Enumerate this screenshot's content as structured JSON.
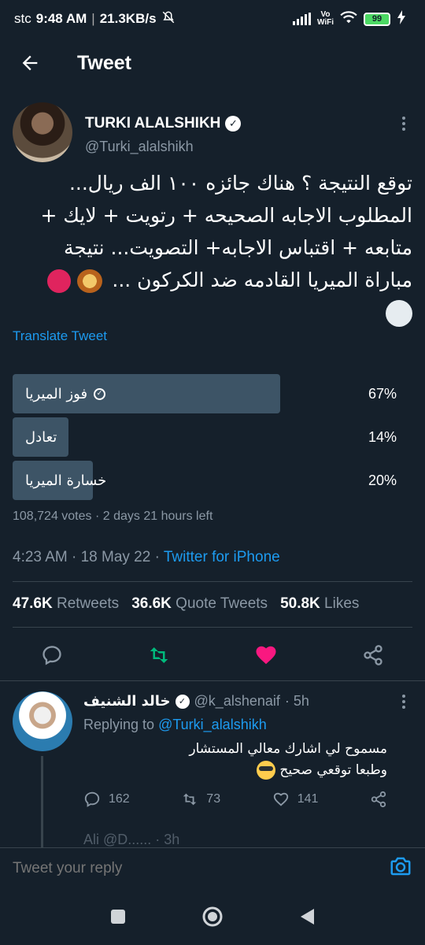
{
  "status_bar": {
    "carrier": "stc",
    "time": "9:48 AM",
    "speed": "21.3KB/s",
    "vowifi_top": "Vo",
    "vowifi_bottom": "WiFi",
    "battery": "99",
    "battery_color": "#4cd964"
  },
  "header": {
    "title": "Tweet",
    "back_icon": "arrow-left-icon"
  },
  "tweet": {
    "author_name": "TURKI ALALSHIKH",
    "author_handle": "@Turki_alalshikh",
    "text_line1": "توقع النتيجة ؟ هناك جائزه ١٠٠ الف ريال...",
    "text_line2": "المطلوب الاجابه الصحيحه + رتويت + لايك +",
    "text_line3": "متابعه + اقتباس الاجابه+ التصويت... نتيجة",
    "text_line4": "مباراة الميريا القادمه ضد الكركون ...",
    "translate": "Translate Tweet",
    "poll": {
      "options": [
        {
          "label": "فوز الميريا",
          "percent": "67%",
          "fraction": 0.67,
          "winner": true
        },
        {
          "label": "تعادل",
          "percent": "14%",
          "fraction": 0.14,
          "winner": false
        },
        {
          "label": "خسارة الميريا",
          "percent": "20%",
          "fraction": 0.2,
          "winner": false
        }
      ],
      "meta": "108,724 votes · 2 days 21 hours left"
    },
    "time": "4:23 AM · 18 May 22 · ",
    "source": "Twitter for iPhone",
    "stats": {
      "retweets_count": "47.6K",
      "retweets_label": "Retweets",
      "quotes_count": "36.6K",
      "quotes_label": "Quote Tweets",
      "likes_count": "50.8K",
      "likes_label": "Likes"
    },
    "accent_color": "#1d9bf0",
    "retweet_color": "#00ba7c",
    "like_color": "#f91880"
  },
  "reply": {
    "name": "خالد الشنيف",
    "handle": "@k_alshenaif",
    "time": "· 5h",
    "replying_prefix": "Replying to ",
    "replying_to": "@Turki_alalshikh",
    "text_line1": "مسموح لي اشارك معالي المستشار",
    "text_line2": "وطبعا توقعي صحيح",
    "replies": "162",
    "retweets": "73",
    "likes": "141"
  },
  "next_reply_preview": "Ali @D...... · 3h",
  "compose": {
    "placeholder": "Tweet your reply"
  }
}
